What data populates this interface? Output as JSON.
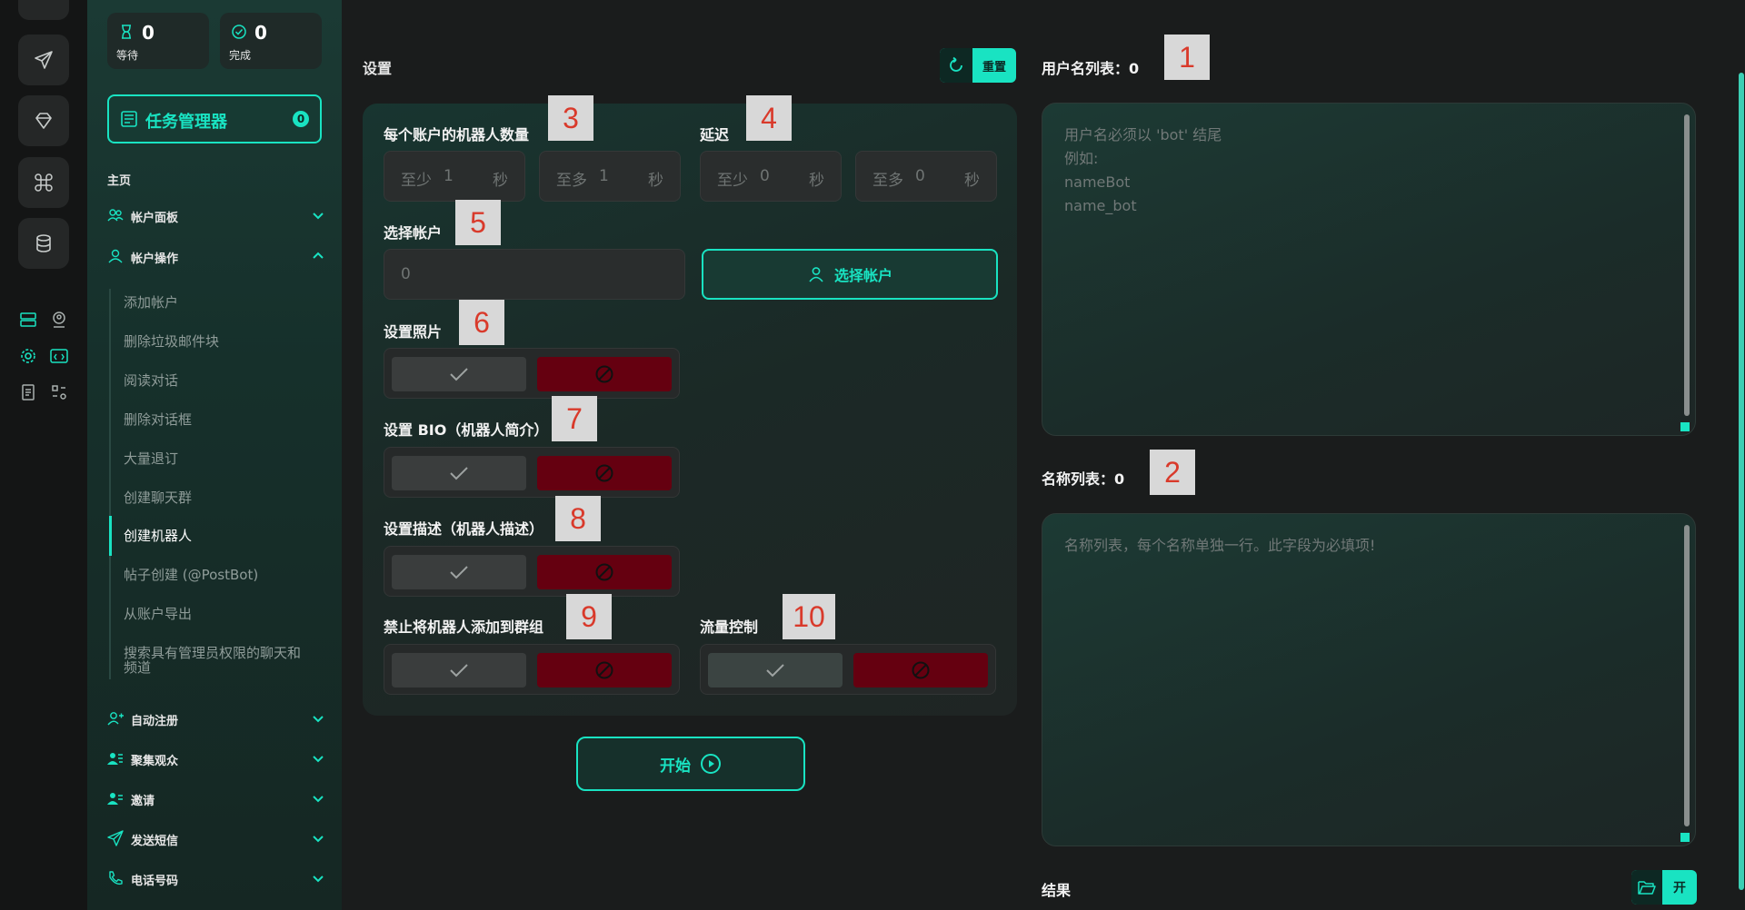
{
  "colors": {
    "accent": "#19e3c2",
    "danger": "#650010",
    "marker_text": "#d93a2b",
    "marker_bg": "#d8d8d8"
  },
  "stats": {
    "waiting": {
      "value": "0",
      "label": "等待"
    },
    "done": {
      "value": "0",
      "label": "完成"
    }
  },
  "task_manager": {
    "label": "任务管理器",
    "count": "0"
  },
  "sidebar": {
    "home_label": "主页",
    "sections_top": [
      {
        "label": "帐户面板",
        "icon": "users-icon"
      },
      {
        "label": "帐户操作",
        "icon": "user-icon"
      }
    ],
    "sub_items": [
      "添加帐户",
      "删除垃圾邮件块",
      "阅读对话",
      "删除对话框",
      "大量退订",
      "创建聊天群",
      "创建机器人",
      "帖子创建 (@PostBot)",
      "从账户导出",
      "搜索具有管理员权限的聊天和频道"
    ],
    "active_sub": "创建机器人",
    "sections_bottom": [
      {
        "label": "自动注册",
        "icon": "user-plus-icon"
      },
      {
        "label": "聚集观众",
        "icon": "audience-icon"
      },
      {
        "label": "邀请",
        "icon": "invite-icon"
      },
      {
        "label": "发送短信",
        "icon": "send-icon"
      },
      {
        "label": "电话号码",
        "icon": "phone-icon"
      }
    ]
  },
  "main": {
    "title": "设置",
    "reset_label": "重置",
    "bots_per_account": {
      "label": "每个账户的机器人数量",
      "min": {
        "prefix": "至少",
        "value": "1",
        "unit": "秒"
      },
      "max": {
        "prefix": "至多",
        "value": "1",
        "unit": "秒"
      }
    },
    "delay": {
      "label": "延迟",
      "min": {
        "prefix": "至少",
        "value": "0",
        "unit": "秒"
      },
      "max": {
        "prefix": "至多",
        "value": "0",
        "unit": "秒"
      }
    },
    "select_account": {
      "label": "选择帐户",
      "value": "0",
      "button": "选择帐户"
    },
    "set_photo": {
      "label": "设置照片"
    },
    "set_bio": {
      "label": "设置 BIO（机器人简介）"
    },
    "set_description": {
      "label": "设置描述（机器人描述）"
    },
    "forbid_groups": {
      "label": "禁止将机器人添加到群组"
    },
    "flow_control": {
      "label": "流量控制"
    },
    "start_label": "开始"
  },
  "right": {
    "usernames_header": "用户名列表：0",
    "usernames_placeholder": "用户名必须以 'bot' 结尾\n例如:\nnameBot\nname_bot",
    "names_header": "名称列表：0",
    "names_placeholder": "名称列表，每个名称单独一行。此字段为必填项!",
    "results_header": "结果",
    "open_label": "开"
  },
  "markers": [
    "1",
    "2",
    "3",
    "4",
    "5",
    "6",
    "7",
    "8",
    "9",
    "10"
  ]
}
